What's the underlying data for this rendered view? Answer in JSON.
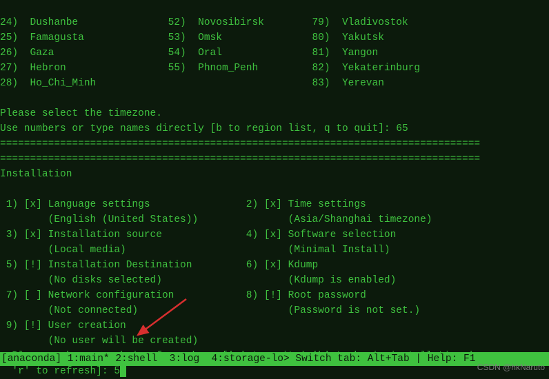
{
  "tz_list": [
    {
      "n": "24",
      "name": "Dushanbe",
      "n2": "52",
      "name2": "Novosibirsk",
      "n3": "79",
      "name3": "Vladivostok"
    },
    {
      "n": "25",
      "name": "Famagusta",
      "n2": "53",
      "name2": "Omsk",
      "n3": "80",
      "name3": "Yakutsk"
    },
    {
      "n": "26",
      "name": "Gaza",
      "n2": "54",
      "name2": "Oral",
      "n3": "81",
      "name3": "Yangon"
    },
    {
      "n": "27",
      "name": "Hebron",
      "n2": "55",
      "name2": "Phnom_Penh",
      "n3": "82",
      "name3": "Yekaterinburg"
    },
    {
      "n": "28",
      "name": "Ho_Chi_Minh",
      "n2": "",
      "name2": "",
      "n3": "83",
      "name3": "Yerevan"
    }
  ],
  "tz_prompt1": "Please select the timezone.",
  "tz_prompt2": "Use numbers or type names directly [b to region list, q to quit]: ",
  "tz_input": "65",
  "divider": "================================================================================",
  "section_title": "Installation",
  "menu": [
    {
      "ln": " 1",
      "lm": "[x]",
      "lt": "Language settings",
      "ls": "(English (United States))",
      "rn": " 2",
      "rm": "[x]",
      "rt": "Time settings",
      "rs": "(Asia/Shanghai timezone)"
    },
    {
      "ln": " 3",
      "lm": "[x]",
      "lt": "Installation source",
      "ls": "(Local media)",
      "rn": " 4",
      "rm": "[x]",
      "rt": "Software selection",
      "rs": "(Minimal Install)"
    },
    {
      "ln": " 5",
      "lm": "[!]",
      "lt": "Installation Destination",
      "ls": "(No disks selected)",
      "rn": " 6",
      "rm": "[x]",
      "rt": "Kdump",
      "rs": "(Kdump is enabled)"
    },
    {
      "ln": " 7",
      "lm": "[ ]",
      "lt": "Network configuration",
      "ls": "(Not connected)",
      "rn": " 8",
      "rm": "[!]",
      "rt": "Root password",
      "rs": "(Password is not set.)"
    },
    {
      "ln": " 9",
      "lm": "[!]",
      "lt": "User creation",
      "ls": "(No user will be created)",
      "rn": "",
      "rm": "",
      "rt": "",
      "rs": ""
    }
  ],
  "choice_prompt": "  Please make your choice from above ['q' to quit | 'b' to begin installation |\n  'r' to refresh]: ",
  "choice_input": "5",
  "status_bar": "[anaconda] 1:main* 2:shell  3:log  4:storage-lo> Switch tab: Alt+Tab | Help: F1",
  "watermark": "CSDN @hkNaruto"
}
